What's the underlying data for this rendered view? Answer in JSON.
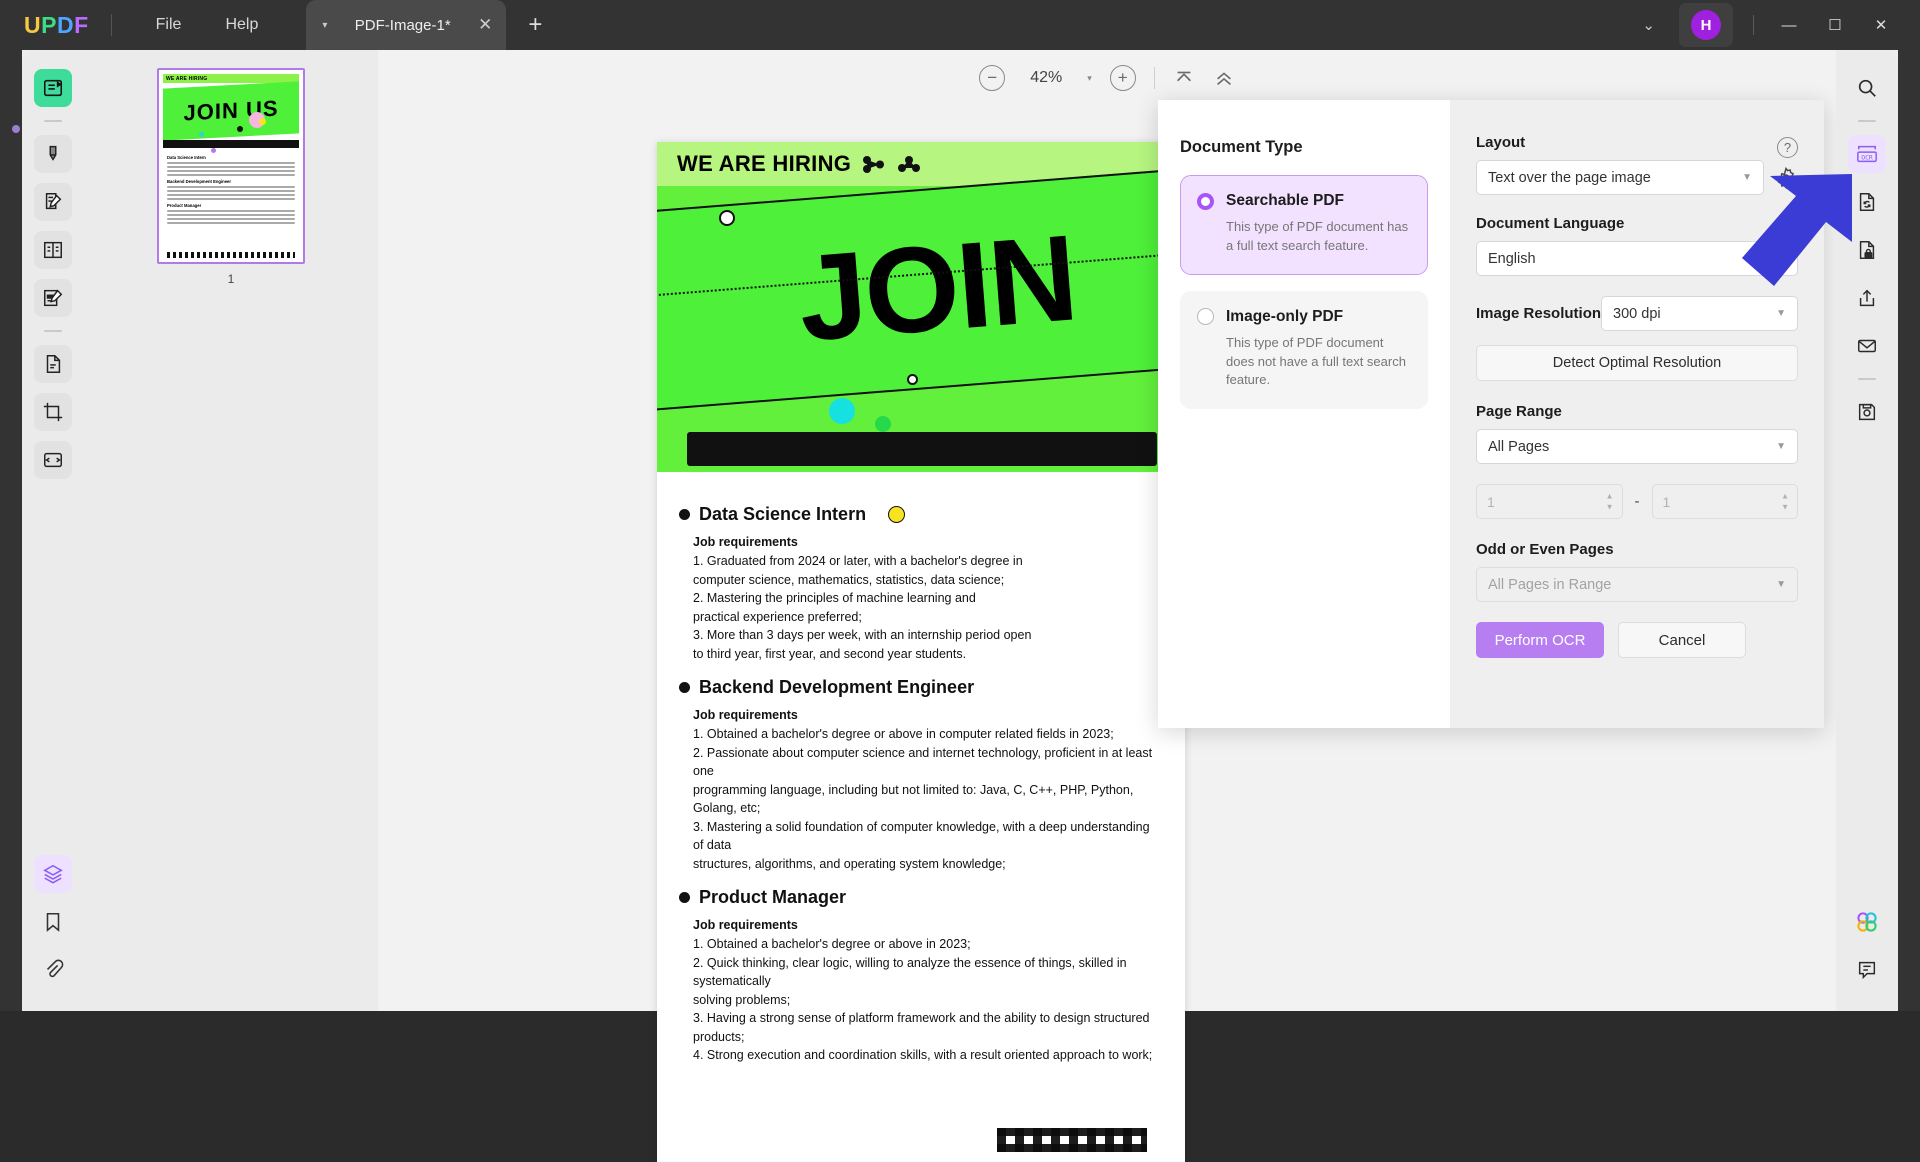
{
  "titlebar": {
    "logo": [
      "U",
      "P",
      "D",
      "F"
    ],
    "menus": [
      {
        "label": "File",
        "name": "menu-file"
      },
      {
        "label": "Help",
        "name": "menu-help"
      }
    ],
    "tab": {
      "title": "PDF-Image-1*",
      "caret": "▾",
      "close": "✕"
    },
    "new_tab": "+",
    "chevron_down": "⌄",
    "avatar_initial": "H",
    "window": {
      "minimize": "—",
      "maximize": "☐",
      "close": "✕"
    }
  },
  "left_tools": [
    {
      "name": "tool-reader",
      "icon": "reader-icon",
      "state": "active"
    },
    {
      "sep": true
    },
    {
      "name": "tool-highlighter",
      "icon": "marker-icon",
      "state": "normal"
    },
    {
      "name": "tool-edit-text",
      "icon": "edit-text-icon",
      "state": "normal"
    },
    {
      "name": "tool-organize-pages",
      "icon": "pages-icon",
      "state": "normal"
    },
    {
      "name": "tool-comment",
      "icon": "comment-edit-icon",
      "state": "normal"
    },
    {
      "sep": true
    },
    {
      "name": "tool-page-extract",
      "icon": "document-copy-icon",
      "state": "normal"
    },
    {
      "name": "tool-crop",
      "icon": "crop-icon",
      "state": "normal"
    },
    {
      "name": "tool-compare",
      "icon": "compare-icon",
      "state": "normal"
    }
  ],
  "left_tools_bottom": [
    {
      "name": "tool-layers",
      "icon": "layers-icon",
      "state": "purple"
    },
    {
      "name": "tool-bookmarks",
      "icon": "bookmark-icon",
      "state": "plain"
    },
    {
      "name": "tool-attachments",
      "icon": "paperclip-icon",
      "state": "plain"
    }
  ],
  "thumbnail_panel": {
    "page_number": "1",
    "poster": {
      "hiring": "WE ARE HIRING",
      "join": "JOIN US",
      "lines": [
        "Data Science Intern",
        "Backend Development Engineer",
        "Product Manager"
      ]
    }
  },
  "zoombar": {
    "zoom_out": "−",
    "zoom_level": "42%",
    "caret": "▾",
    "zoom_in": "+",
    "fit_top": "⌃",
    "fit_all": "⌃"
  },
  "document": {
    "poster": {
      "hiring_text": "WE ARE HIRING",
      "join_text": "JOIN"
    },
    "jobs": [
      {
        "title": "Data Science Intern",
        "has_yellow_marker": true,
        "req_title": "Job requirements",
        "requirements": [
          "1. Graduated from 2024 or later, with a bachelor's degree in",
          "computer science, mathematics, statistics, data science;",
          "2. Mastering the principles of machine learning and",
          "practical experience preferred;",
          "3. More than 3 days per week, with an internship period open",
          "to third year, first year, and second year students."
        ]
      },
      {
        "title": "Backend Development Engineer",
        "has_yellow_marker": false,
        "req_title": "Job requirements",
        "requirements": [
          "1. Obtained a bachelor's degree or above in computer related fields in 2023;",
          "2. Passionate about computer science and internet technology, proficient in at least one",
          "programming language, including but not limited to: Java, C, C++, PHP, Python, Golang, etc;",
          "3. Mastering a solid foundation of computer knowledge, with a deep understanding of data",
          "structures, algorithms, and operating system knowledge;"
        ]
      },
      {
        "title": "Product Manager",
        "has_yellow_marker": false,
        "req_title": "Job requirements",
        "requirements": [
          "1. Obtained a bachelor's degree or above in 2023;",
          "2. Quick thinking, clear logic, willing to analyze the essence of things, skilled in systematically",
          "solving problems;",
          "3. Having a strong sense of platform framework and the ability to design structured products;",
          "4. Strong execution and coordination skills, with a result oriented approach to work;"
        ]
      }
    ]
  },
  "ocr_dialog": {
    "document_type": {
      "heading": "Document Type",
      "options": [
        {
          "label": "Searchable PDF",
          "description": "This type of PDF document has a full text search feature.",
          "selected": true
        },
        {
          "label": "Image-only PDF",
          "description": "This type of PDF document does not have a full text search feature.",
          "selected": false
        }
      ]
    },
    "settings": {
      "layout_label": "Layout",
      "layout_value": "Text over the page image",
      "help_icon": "?",
      "gear_icon": "settings-icon",
      "language_label": "Document Language",
      "language_value": "English",
      "resolution_label": "Image Resolution",
      "resolution_value": "300 dpi",
      "detect_button": "Detect Optimal Resolution",
      "page_range_label": "Page Range",
      "page_range_value": "All Pages",
      "range_from": "1",
      "range_to": "1",
      "range_dash": "-",
      "odd_even_label": "Odd or Even Pages",
      "odd_even_value": "All Pages in Range",
      "perform_button": "Perform OCR",
      "cancel_button": "Cancel"
    }
  },
  "right_tools": [
    {
      "name": "tool-search",
      "icon": "search-icon",
      "state": "plain"
    },
    {
      "sep": true
    },
    {
      "name": "tool-ocr",
      "icon": "ocr-icon",
      "state": "purple"
    },
    {
      "name": "tool-convert",
      "icon": "convert-doc-icon",
      "state": "plain"
    },
    {
      "name": "tool-protect",
      "icon": "lock-doc-icon",
      "state": "plain"
    },
    {
      "name": "tool-share",
      "icon": "share-upload-icon",
      "state": "plain"
    },
    {
      "name": "tool-email",
      "icon": "envelope-icon",
      "state": "plain"
    },
    {
      "sep": true
    },
    {
      "name": "tool-save",
      "icon": "save-disk-icon",
      "state": "plain"
    }
  ],
  "right_tools_bottom": [
    {
      "name": "tool-ai-assistant",
      "icon": "ai-flower-icon",
      "state": "plain"
    },
    {
      "name": "tool-feedback",
      "icon": "chat-bubble-icon",
      "state": "plain"
    }
  ],
  "colors": {
    "accent_purple": "#a855f7",
    "primary_button": "#b77ef2",
    "selected_bg": "#f2e2ff",
    "active_green": "#3ddc9a",
    "poster_green": "#4ef03a",
    "arrow_blue": "#3b3bd6",
    "titlebar": "#333333"
  }
}
